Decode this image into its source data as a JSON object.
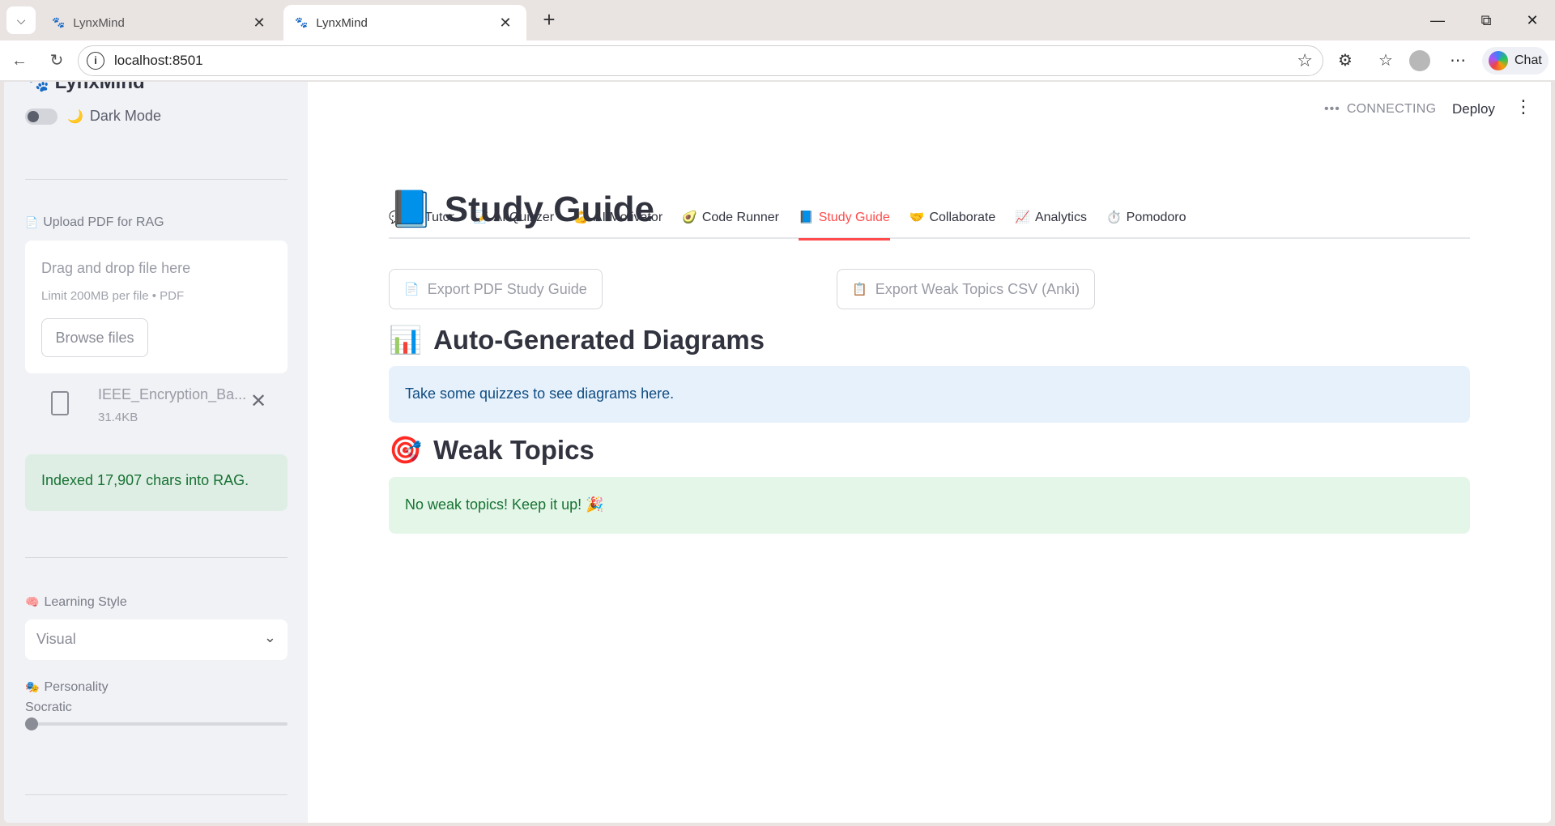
{
  "browser": {
    "tabs": [
      {
        "title": "LynxMind",
        "active": false
      },
      {
        "title": "LynxMind",
        "active": true
      }
    ],
    "url": "localhost:8501",
    "chat_label": "Chat"
  },
  "sidebar": {
    "brand": "LynxMind",
    "dark_mode_label": "Dark Mode",
    "upload_label": "Upload PDF for RAG",
    "dropzone_text": "Drag and drop file here",
    "dropzone_limit": "Limit 200MB per file • PDF",
    "browse_label": "Browse files",
    "file_name": "IEEE_Encryption_Ba...",
    "file_size": "31.4KB",
    "indexed_message": "Indexed 17,907 chars into RAG.",
    "learning_style_label": "Learning Style",
    "learning_style_value": "Visual",
    "personality_label": "Personality",
    "personality_value": "Socratic",
    "personality_level": 0
  },
  "header": {
    "status": "CONNECTING",
    "deploy_label": "Deploy"
  },
  "tabs": [
    {
      "emoji": "💬",
      "label": "AI Tutor"
    },
    {
      "emoji": "📝",
      "label": "AI Quizzer"
    },
    {
      "emoji": "💪",
      "label": "AI Motivator"
    },
    {
      "emoji": "🥑",
      "label": "Code Runner"
    },
    {
      "emoji": "📘",
      "label": "Study Guide"
    },
    {
      "emoji": "🤝",
      "label": "Collaborate"
    },
    {
      "emoji": "📈",
      "label": "Analytics"
    },
    {
      "emoji": "⏱️",
      "label": "Pomodoro"
    }
  ],
  "active_tab": 4,
  "main": {
    "title_emoji": "📘",
    "title": "Study Guide",
    "export_pdf_label": "Export PDF Study Guide",
    "export_csv_label": "Export Weak Topics CSV (Anki)",
    "diagrams_emoji": "📊",
    "diagrams_heading": "Auto-Generated Diagrams",
    "diagrams_info": "Take some quizzes to see diagrams here.",
    "weak_emoji": "🎯",
    "weak_heading": "Weak Topics",
    "weak_message": "No weak topics! Keep it up! 🎉"
  },
  "colors": {
    "accent": "#ff4b4b",
    "info_bg": "#e6f1fc",
    "success_bg": "#e3f6e8",
    "sidebar_bg": "#f0f2f6"
  }
}
